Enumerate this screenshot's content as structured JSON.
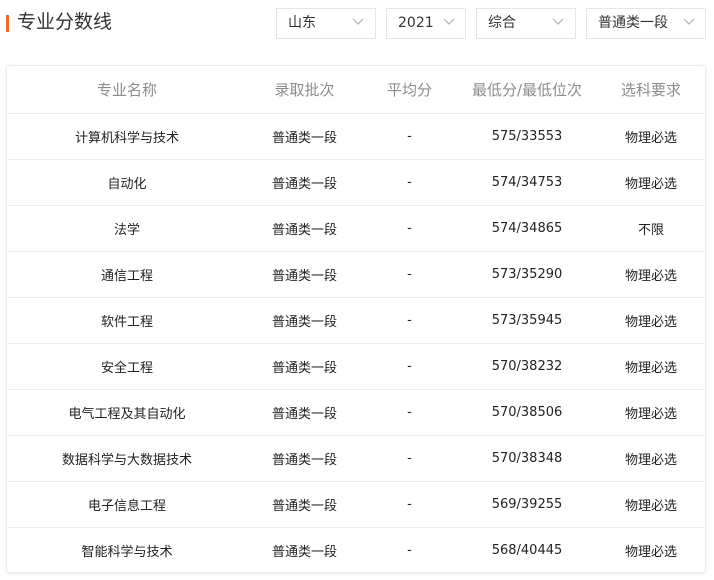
{
  "header": {
    "title": "专业分数线"
  },
  "filters": {
    "province": "山东",
    "year": "2021",
    "subject_type": "综合",
    "batch": "普通类一段"
  },
  "table": {
    "columns": [
      "专业名称",
      "录取批次",
      "平均分",
      "最低分/最低位次",
      "选科要求"
    ],
    "rows": [
      {
        "major": "计算机科学与技术",
        "batch": "普通类一段",
        "avg": "-",
        "min": "575/33553",
        "req": "物理必选"
      },
      {
        "major": "自动化",
        "batch": "普通类一段",
        "avg": "-",
        "min": "574/34753",
        "req": "物理必选"
      },
      {
        "major": "法学",
        "batch": "普通类一段",
        "avg": "-",
        "min": "574/34865",
        "req": "不限"
      },
      {
        "major": "通信工程",
        "batch": "普通类一段",
        "avg": "-",
        "min": "573/35290",
        "req": "物理必选"
      },
      {
        "major": "软件工程",
        "batch": "普通类一段",
        "avg": "-",
        "min": "573/35945",
        "req": "物理必选"
      },
      {
        "major": "安全工程",
        "batch": "普通类一段",
        "avg": "-",
        "min": "570/38232",
        "req": "物理必选"
      },
      {
        "major": "电气工程及其自动化",
        "batch": "普通类一段",
        "avg": "-",
        "min": "570/38506",
        "req": "物理必选"
      },
      {
        "major": "数据科学与大数据技术",
        "batch": "普通类一段",
        "avg": "-",
        "min": "570/38348",
        "req": "物理必选"
      },
      {
        "major": "电子信息工程",
        "batch": "普通类一段",
        "avg": "-",
        "min": "569/39255",
        "req": "物理必选"
      },
      {
        "major": "智能科学与技术",
        "batch": "普通类一段",
        "avg": "-",
        "min": "568/40445",
        "req": "物理必选"
      }
    ]
  },
  "colors": {
    "accent": "#f26a21",
    "header_text": "#8c8c8c",
    "border": "#ececec"
  },
  "icons": {
    "dropdown": "chevron-down-icon"
  }
}
